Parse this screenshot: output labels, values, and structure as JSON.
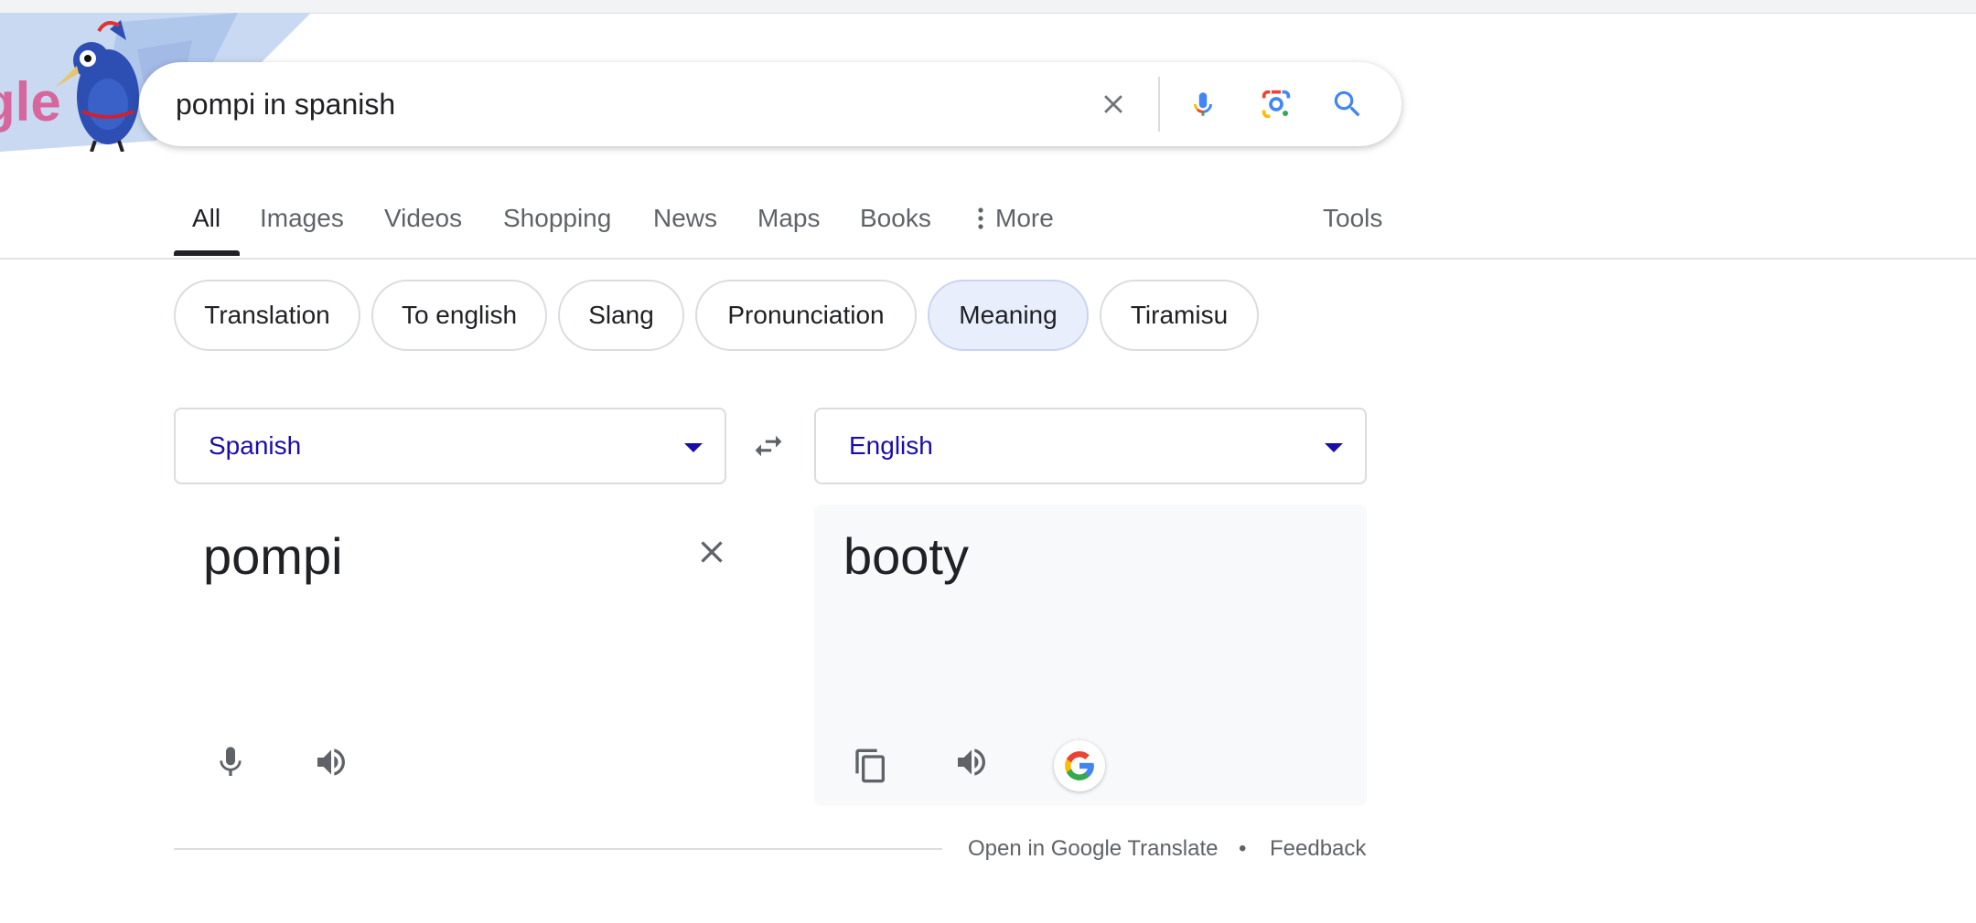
{
  "search": {
    "query": "pompi in spanish",
    "logo_text": "gle"
  },
  "tabs": [
    {
      "label": "All",
      "active": true
    },
    {
      "label": "Images"
    },
    {
      "label": "Videos"
    },
    {
      "label": "Shopping"
    },
    {
      "label": "News"
    },
    {
      "label": "Maps"
    },
    {
      "label": "Books"
    },
    {
      "label": "More",
      "icon": "more-vert-icon"
    },
    {
      "label": "Tools"
    }
  ],
  "chips": [
    {
      "label": "Translation"
    },
    {
      "label": "To english"
    },
    {
      "label": "Slang"
    },
    {
      "label": "Pronunciation"
    },
    {
      "label": "Meaning",
      "selected": true
    },
    {
      "label": "Tiramisu"
    }
  ],
  "translate": {
    "source_lang": "Spanish",
    "target_lang": "English",
    "source_text": "pompi",
    "target_text": "booty"
  },
  "footer": {
    "open_link": "Open in Google Translate",
    "separator": "•",
    "feedback": "Feedback"
  },
  "colors": {
    "link_blue": "#1a0dab",
    "chip_selected_bg": "#e8eefc",
    "google_blue": "#4285f4",
    "google_red": "#ea4335",
    "google_yellow": "#fbbc05",
    "google_green": "#34a853"
  }
}
